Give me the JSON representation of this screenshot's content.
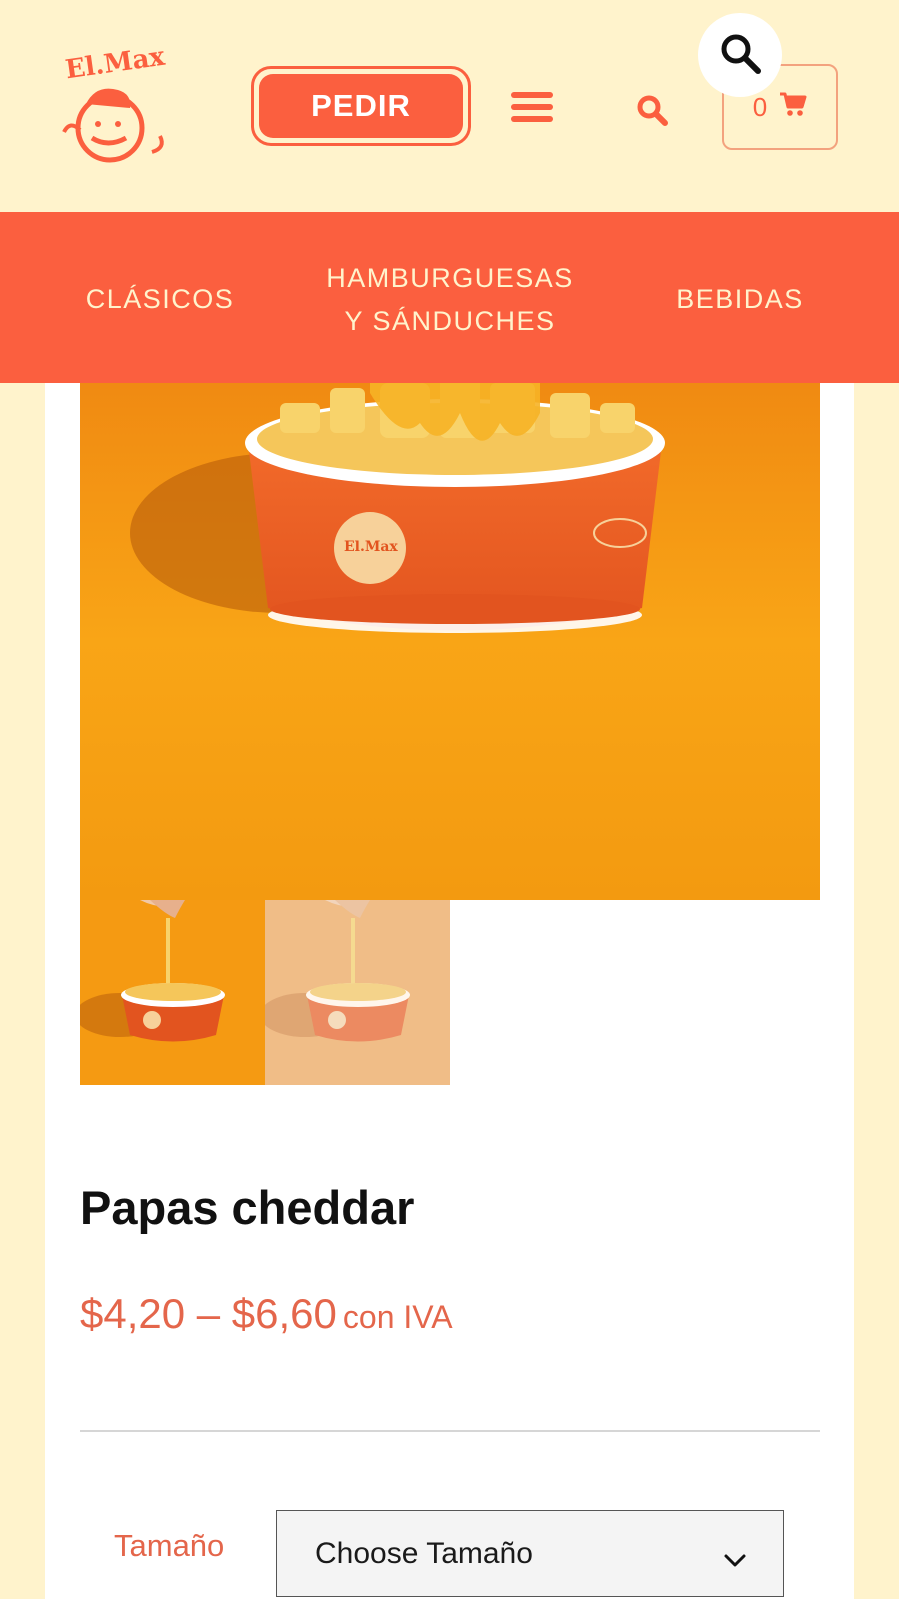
{
  "header": {
    "logo_text": "El.Max",
    "order_button": "PEDIR",
    "menu_icon": "hamburger-menu-icon",
    "search_icon": "search-icon",
    "cart": {
      "count": "0",
      "icon": "cart-icon"
    }
  },
  "categories": [
    {
      "label": "CLÁSICOS"
    },
    {
      "label": "HAMBURGUESAS Y SÁNDUCHES",
      "line1": "HAMBURGUESAS",
      "line2": "Y SÁNDUCHES"
    },
    {
      "label": "BEBIDAS"
    }
  ],
  "product": {
    "title": "Papas cheddar",
    "price_range": "$4,20 – $6,60",
    "price_suffix": "con IVA",
    "gallery": [
      "main",
      "thumb-1",
      "thumb-2"
    ]
  },
  "variation": {
    "label": "Tamaño",
    "selected": "Choose Tamaño"
  },
  "colors": {
    "accent": "#fb5f3f",
    "background": "#fff3cc",
    "price": "#e4664b"
  }
}
